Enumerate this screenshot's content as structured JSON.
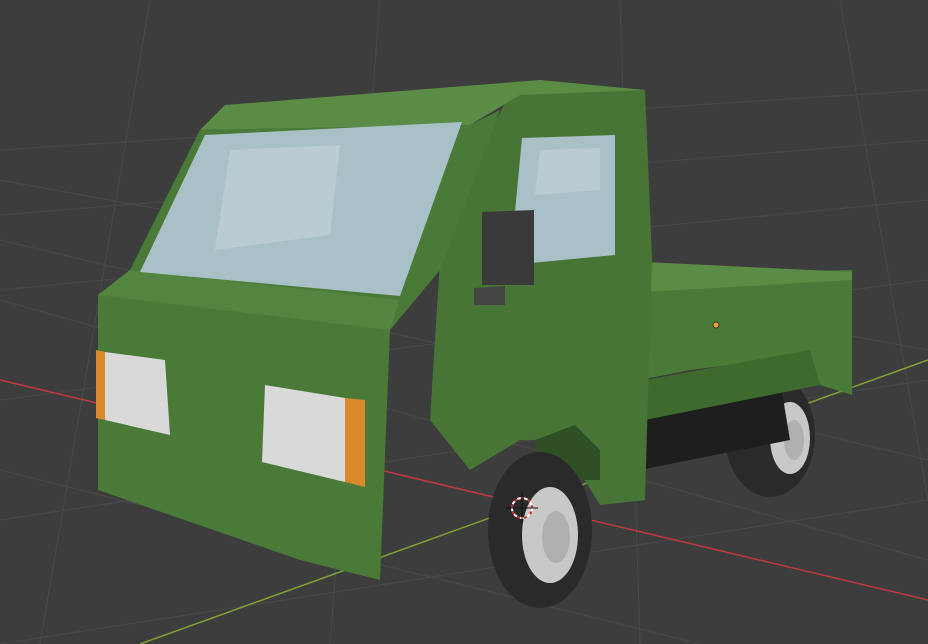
{
  "viewport": {
    "background": "#3d3d3d",
    "grid_color": "#4a4a4a",
    "x_axis_color": "#c0393d",
    "y_axis_color": "#7fa033"
  },
  "model": {
    "body_color": "#4a7a38",
    "body_dark": "#3e6a2e",
    "body_light": "#5a8c46",
    "glass_color": "#a9c0c6",
    "headlight_color": "#d9d9d9",
    "indicator_color": "#d98a2a",
    "tire_color": "#2a2a2a",
    "rim_color": "#c8c8c8",
    "mirror_color": "#3a3a3a"
  },
  "gizmos": {
    "origin_dot_icon": "origin-point-icon",
    "cursor_icon": "3d-cursor-icon"
  }
}
